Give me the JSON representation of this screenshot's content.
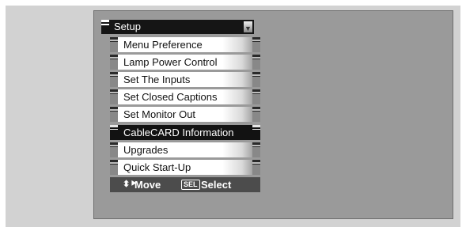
{
  "menu": {
    "title": "Setup",
    "items": [
      {
        "label": "Menu Preference",
        "selected": false
      },
      {
        "label": "Lamp Power Control",
        "selected": false
      },
      {
        "label": "Set The Inputs",
        "selected": false
      },
      {
        "label": "Set Closed Captions",
        "selected": false
      },
      {
        "label": "Set Monitor Out",
        "selected": false
      },
      {
        "label": "CableCARD Information",
        "selected": true
      },
      {
        "label": "Upgrades",
        "selected": false
      },
      {
        "label": "Quick Start-Up",
        "selected": false
      }
    ]
  },
  "footer": {
    "move_label": "Move",
    "select_key": "SEL",
    "select_label": "Select",
    "move_icon": "dpad-arrows-icon"
  },
  "colors": {
    "screen_bg": "#9a9a9a",
    "selected_bg": "#121212",
    "footer_bg": "#4c4c4c"
  }
}
